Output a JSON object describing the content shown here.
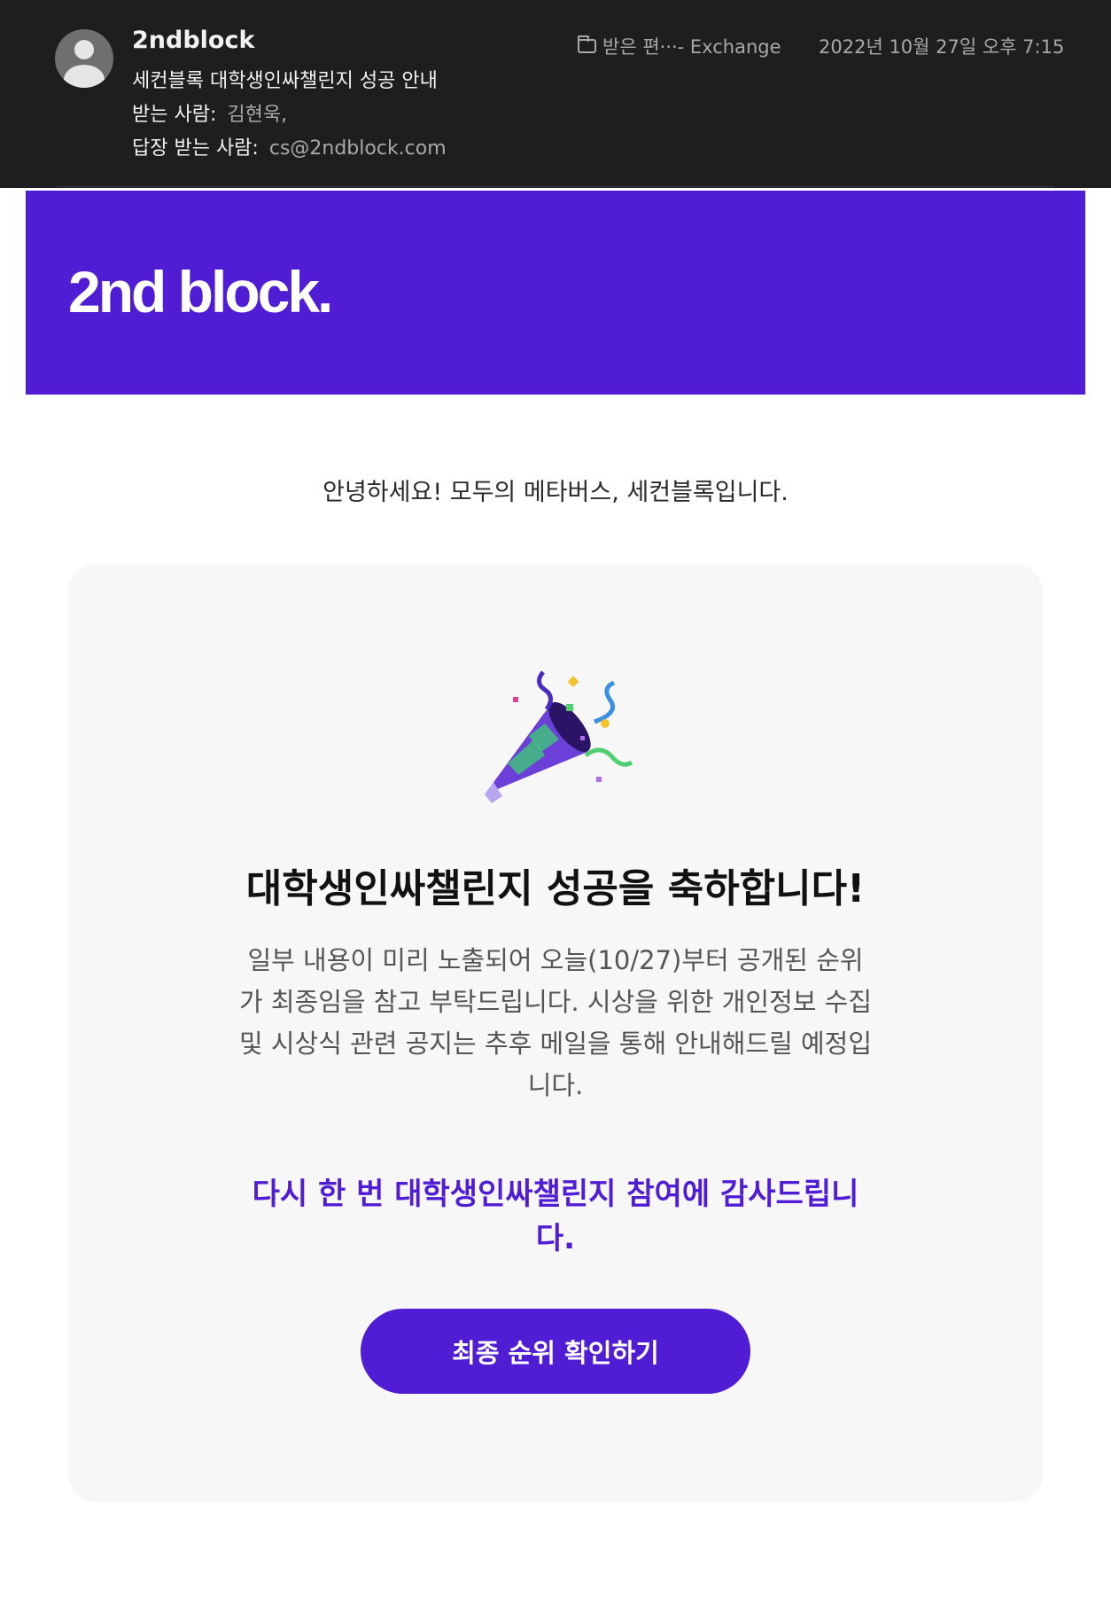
{
  "mail": {
    "sender": "2ndblock",
    "subject": "세컨블록 대학생인싸챌린지 성공 안내",
    "to_label": "받는 사람:",
    "to_value": "김현욱,",
    "reply_label": "답장 받는 사람:",
    "reply_value": "cs@2ndblock.com",
    "folder": "받은 편···- Exchange",
    "date": "2022년 10월 27일 오후 7:15"
  },
  "banner": {
    "logo_text": "2nd block.",
    "color": "#501cd4"
  },
  "greeting": "안녕하세요! 모두의 메타버스, 세컨블록입니다.",
  "card": {
    "icon": "party-popper-icon",
    "title": "대학생인싸챌린지 성공을 축하합니다!",
    "body": "일부 내용이 미리 노출되어 오늘(10/27)부터 공개된 순위가 최종임을 참고 부탁드립니다. 시상을 위한 개인정보 수집 및 시상식 관련 공지는 추후 메일을 통해 안내해드릴 예정입니다.",
    "thanks": "다시 한 번 대학생인싸챌린지 참여에 감사드립니다.",
    "button_label": "최종 순위 확인하기"
  },
  "colors": {
    "accent": "#501cd4",
    "header_bg": "#1e1e1e",
    "card_bg": "#f7f7f8"
  }
}
